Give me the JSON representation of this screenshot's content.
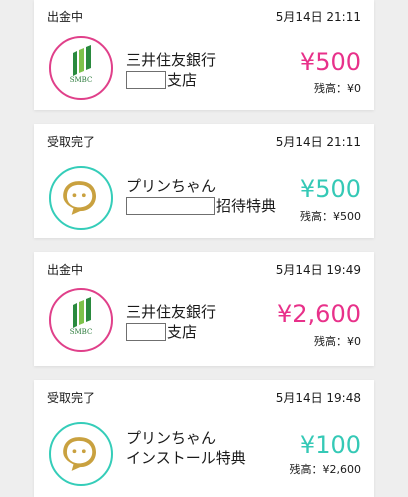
{
  "transactions": [
    {
      "status": "出金中",
      "datetime": "5月14日 21:11",
      "name_line1": "三井住友銀行",
      "name_line2_suffix": "支店",
      "amount": "¥500",
      "balance": "残高：¥0",
      "logo": "smbc-logo-icon",
      "logo_text": "SMBC"
    },
    {
      "status": "受取完了",
      "datetime": "5月14日 21:11",
      "name_line1": "プリンちゃん",
      "name_line2_suffix": "招待特典",
      "amount": "¥500",
      "balance": "残高：¥500",
      "logo": "purin-chat-bubble-icon"
    },
    {
      "status": "出金中",
      "datetime": "5月14日 19:49",
      "name_line1": "三井住友銀行",
      "name_line2_suffix": "支店",
      "amount": "¥2,600",
      "balance": "残高：¥0",
      "logo": "smbc-logo-icon",
      "logo_text": "SMBC"
    },
    {
      "status": "受取完了",
      "datetime": "5月14日 19:48",
      "name_line1": "プリンちゃん",
      "name_line2": "インストール特典",
      "amount": "¥100",
      "balance": "残高：¥2,600",
      "logo": "purin-chat-bubble-icon"
    }
  ],
  "colors": {
    "pink": "#e8318a",
    "teal": "#35c9b6",
    "smbc_green": "#2a8a3e",
    "purin_gold": "#c9a13f"
  }
}
